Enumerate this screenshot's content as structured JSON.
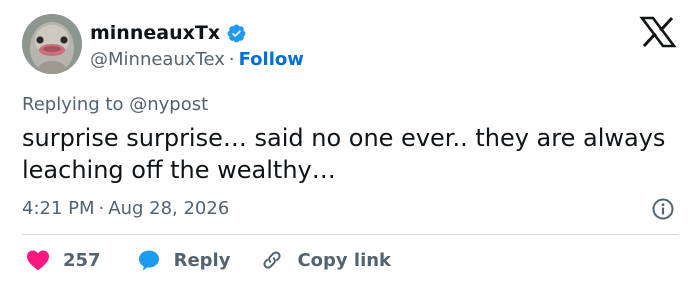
{
  "user": {
    "display_name": "minneauxTx",
    "handle": "@MinneauxTex",
    "separator": "·",
    "follow_label": "Follow",
    "verified": true
  },
  "tweet": {
    "replying_prefix": "Replying to",
    "replying_to": "@nypost",
    "text": "surprise surprise… said no one ever.. they are always leaching off the wealthy…",
    "time": "4:21 PM",
    "separator": "·",
    "date": "Aug 28, 2026"
  },
  "actions": {
    "like_count": "257",
    "reply_label": "Reply",
    "copy_label": "Copy link"
  },
  "colors": {
    "text": "#0f1419",
    "secondary": "#536471",
    "link": "#006fd6",
    "verified": "#1d9bf0",
    "like": "#f91880",
    "reply": "#1d9bf0"
  },
  "icons": {
    "verified": "verified-badge-icon",
    "logo": "x-logo-icon",
    "info": "info-icon",
    "like": "heart-icon",
    "reply": "speech-bubble-icon",
    "copy": "link-icon"
  }
}
